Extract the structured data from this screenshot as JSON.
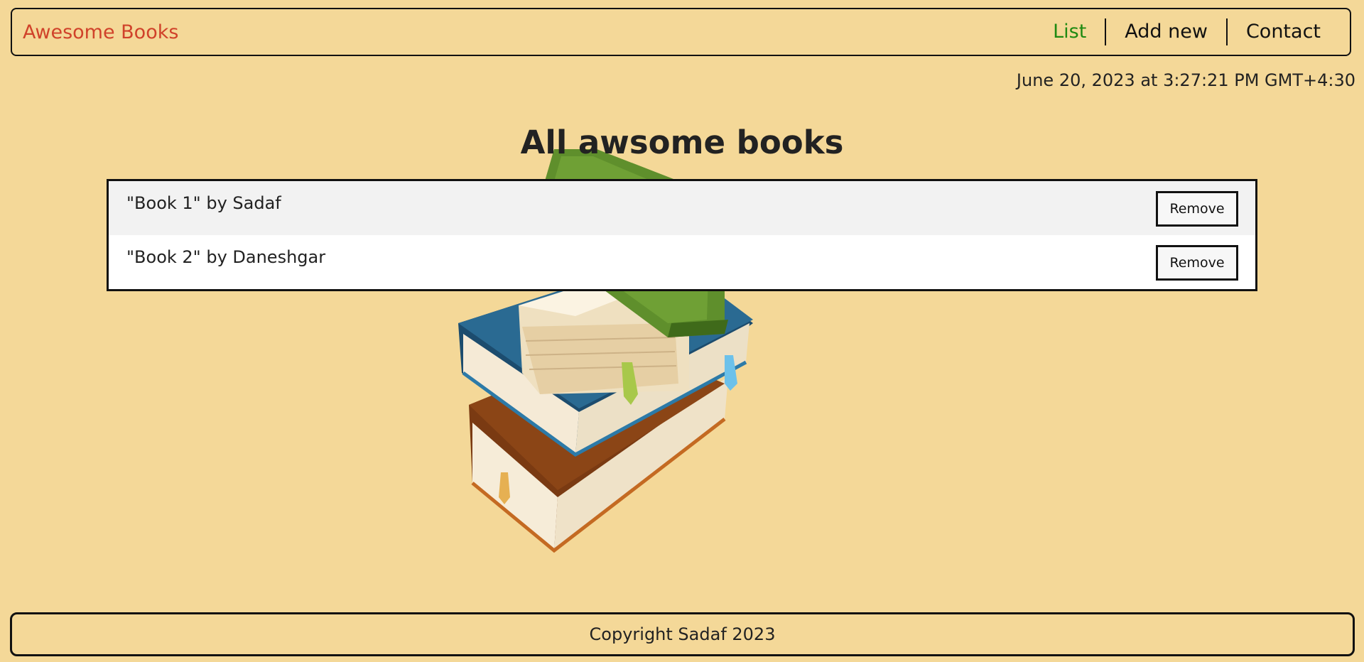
{
  "nav": {
    "brand": "Awesome Books",
    "links": [
      {
        "label": "List",
        "active": true
      },
      {
        "label": "Add new",
        "active": false
      },
      {
        "label": "Contact",
        "active": false
      }
    ]
  },
  "datetime": "June 20, 2023 at 3:27:21 PM GMT+4:30",
  "main": {
    "heading": "All awsome books",
    "books": [
      {
        "text": "\"Book 1\" by Sadaf",
        "remove_label": "Remove"
      },
      {
        "text": "\"Book 2\" by Daneshgar",
        "remove_label": "Remove"
      }
    ],
    "hero_image": "stack-of-books-illustration"
  },
  "footer": {
    "copyright": "Copyright Sadaf 2023"
  },
  "colors": {
    "background": "#f4d898",
    "brand": "#d0422a",
    "active_link": "#1f8a12"
  }
}
